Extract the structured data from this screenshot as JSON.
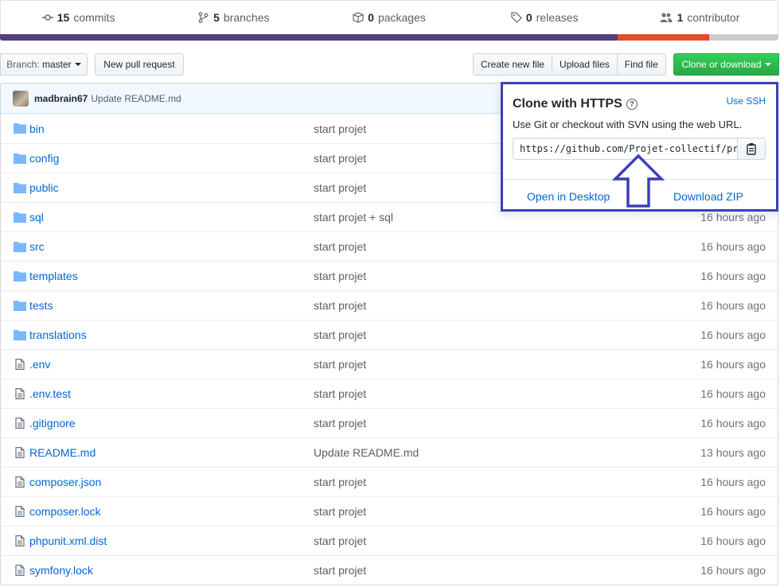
{
  "summary": {
    "commits_count": "15",
    "commits_label": "commits",
    "branches_count": "5",
    "branches_label": "branches",
    "packages_count": "0",
    "packages_label": "packages",
    "releases_count": "0",
    "releases_label": "releases",
    "contributors_count": "1",
    "contributors_label": "contributor"
  },
  "language_colors": [
    "#563d7c",
    "#e34c26",
    "#cccccc"
  ],
  "toolbar": {
    "branch_prefix": "Branch:",
    "branch_name": "master",
    "new_pr": "New pull request",
    "create_file": "Create new file",
    "upload_files": "Upload files",
    "find_file": "Find file",
    "clone_download": "Clone or download"
  },
  "commit": {
    "author": "madbrain67",
    "message": "Update README.md"
  },
  "files": [
    {
      "name": "bin",
      "type": "dir",
      "msg": "start projet",
      "age": ""
    },
    {
      "name": "config",
      "type": "dir",
      "msg": "start projet",
      "age": ""
    },
    {
      "name": "public",
      "type": "dir",
      "msg": "start projet",
      "age": ""
    },
    {
      "name": "sql",
      "type": "dir",
      "msg": "start projet + sql",
      "age": "16 hours ago"
    },
    {
      "name": "src",
      "type": "dir",
      "msg": "start projet",
      "age": "16 hours ago"
    },
    {
      "name": "templates",
      "type": "dir",
      "msg": "start projet",
      "age": "16 hours ago"
    },
    {
      "name": "tests",
      "type": "dir",
      "msg": "start projet",
      "age": "16 hours ago"
    },
    {
      "name": "translations",
      "type": "dir",
      "msg": "start projet",
      "age": "16 hours ago"
    },
    {
      "name": ".env",
      "type": "file",
      "msg": "start projet",
      "age": "16 hours ago"
    },
    {
      "name": ".env.test",
      "type": "file",
      "msg": "start projet",
      "age": "16 hours ago"
    },
    {
      "name": ".gitignore",
      "type": "file",
      "msg": "start projet",
      "age": "16 hours ago"
    },
    {
      "name": "README.md",
      "type": "file",
      "msg": "Update README.md",
      "age": "13 hours ago"
    },
    {
      "name": "composer.json",
      "type": "file",
      "msg": "start projet",
      "age": "16 hours ago"
    },
    {
      "name": "composer.lock",
      "type": "file",
      "msg": "start projet",
      "age": "16 hours ago"
    },
    {
      "name": "phpunit.xml.dist",
      "type": "file",
      "msg": "start projet",
      "age": "16 hours ago"
    },
    {
      "name": "symfony.lock",
      "type": "file",
      "msg": "start projet",
      "age": "16 hours ago"
    }
  ],
  "clone": {
    "title": "Clone with HTTPS",
    "use_ssh": "Use SSH",
    "description": "Use Git or checkout with SVN using the web URL.",
    "url": "https://github.com/Projet-collectif/pr",
    "open_desktop": "Open in Desktop",
    "download_zip": "Download ZIP"
  }
}
